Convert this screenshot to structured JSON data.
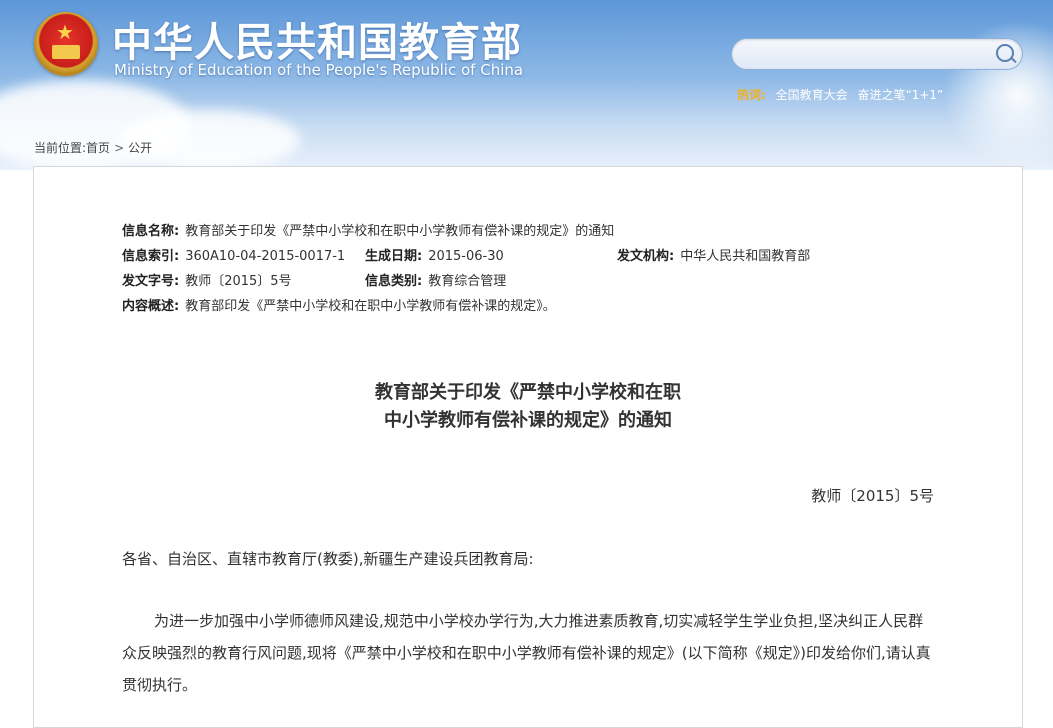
{
  "header": {
    "site_title": "中华人民共和国教育部",
    "site_subtitle": "Ministry of Education of the People's Republic of China",
    "search_placeholder": "",
    "hot_label": "热词:",
    "hot_items": [
      "全国教育大会",
      "奋进之笔“1+1”"
    ]
  },
  "breadcrumb": {
    "prefix": "当前位置:",
    "items": [
      "首页",
      "公开"
    ],
    "separator": ">"
  },
  "meta": {
    "name_key": "信息名称:",
    "name_val": "教育部关于印发《严禁中小学校和在职中小学教师有偿补课的规定》的通知",
    "index_key": "信息索引:",
    "index_val": "360A10-04-2015-0017-1",
    "date_key": "生成日期:",
    "date_val": "2015-06-30",
    "org_key": "发文机构:",
    "org_val": "中华人民共和国教育部",
    "docno_key": "发文字号:",
    "docno_val": "教师〔2015〕5号",
    "cat_key": "信息类别:",
    "cat_val": "教育综合管理",
    "summary_key": "内容概述:",
    "summary_val": "教育部印发《严禁中小学校和在职中小学教师有偿补课的规定》。"
  },
  "document": {
    "title_line1": "教育部关于印发《严禁中小学校和在职",
    "title_line2": "中小学教师有偿补课的规定》的通知",
    "doc_number": "教师〔2015〕5号",
    "salutation": "各省、自治区、直辖市教育厅(教委),新疆生产建设兵团教育局:",
    "body": "为进一步加强中小学师德师风建设,规范中小学校办学行为,大力推进素质教育,切实减轻学生学业负担,坚决纠正人民群众反映强烈的教育行风问题,现将《严禁中小学校和在职中小学教师有偿补课的规定》(以下简称《规定》)印发给你们,请认真贯彻执行。"
  },
  "colors": {
    "header_blue": "#5d97d8",
    "hot_label": "#f3b023"
  },
  "icons": {
    "search": "search-icon",
    "emblem": "national-emblem-icon"
  }
}
